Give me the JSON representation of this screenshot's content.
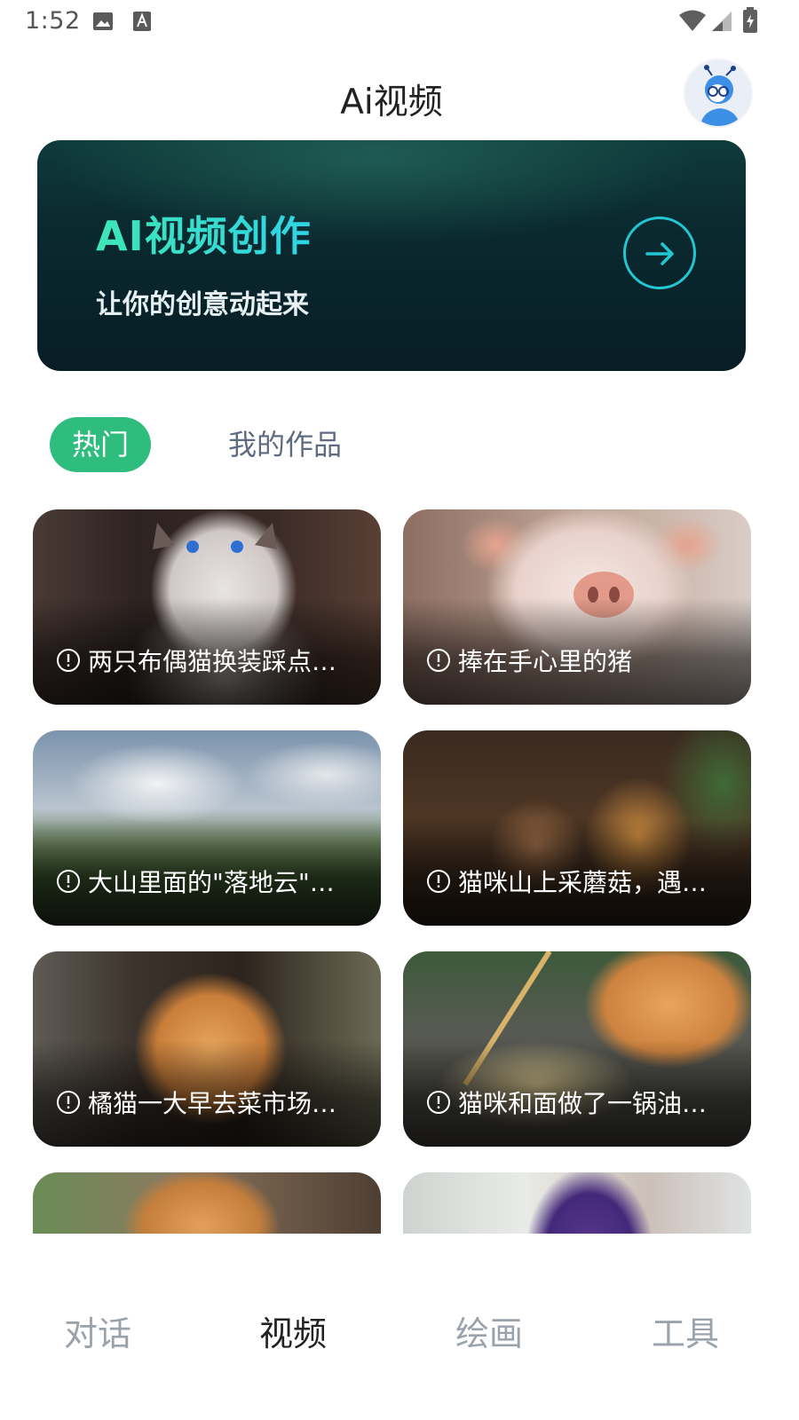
{
  "status_bar": {
    "time": "1:52",
    "icons": [
      "gallery-icon",
      "a-icon",
      "wifi-icon",
      "signal-icon",
      "battery-icon"
    ]
  },
  "header": {
    "title": "Ai视频",
    "avatar": "avatar"
  },
  "banner": {
    "title": "AI视频创作",
    "subtitle": "让你的创意动起来",
    "arrow_icon": "arrow-right-icon"
  },
  "tabs": [
    {
      "label": "热门",
      "active": true
    },
    {
      "label": "我的作品",
      "active": false
    }
  ],
  "cards": [
    {
      "title": "两只布偶猫换装踩点走..."
    },
    {
      "title": "捧在手心里的猪"
    },
    {
      "title": "大山里面的\"落地云\"落..."
    },
    {
      "title": "猫咪山上采蘑菇，遇到..."
    },
    {
      "title": "橘猫一大早去菜市场买..."
    },
    {
      "title": "猫咪和面做了一锅油条..."
    },
    {
      "title": ""
    },
    {
      "title": ""
    }
  ],
  "bottom_nav": [
    {
      "label": "对话",
      "active": false
    },
    {
      "label": "视频",
      "active": true
    },
    {
      "label": "绘画",
      "active": false
    },
    {
      "label": "工具",
      "active": false
    }
  ],
  "colors": {
    "accent_green": "#2fbd7e",
    "banner_cyan": "#22c7d3",
    "inactive_text": "#9aa2ab"
  }
}
